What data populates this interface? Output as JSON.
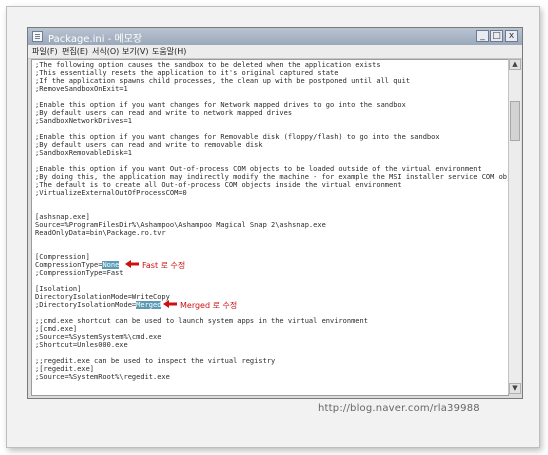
{
  "window": {
    "title": "Package.ini - 메모장",
    "controls": {
      "minimize": "_",
      "maximize": "□",
      "close": "x"
    }
  },
  "menu": [
    "파일(F)",
    "편집(E)",
    "서식(O)",
    "보기(V)",
    "도움말(H)"
  ],
  "lines": [
    ";The following option causes the sandbox to be deleted when the application exists",
    ";This essentially resets the application to it's original captured state",
    ";If the application spawns child processes, the clean up with be postponed until all quit",
    ";RemoveSandboxOnExit=1",
    "",
    ";Enable this option if you want changes for Network mapped drives to go into the sandbox",
    ";By default users can read and write to network mapped drives",
    ";SandboxNetworkDrives=1",
    "",
    ";Enable this option if you want changes for Removable disk (floppy/flash) to go into the sandbox",
    ";By default users can read and write to removable disk",
    ";SandboxRemovableDisk=1",
    "",
    ";Enable this option if you want Out-of-process COM objects to be loaded outside of the virtual environment",
    ";By doing this, the application may indirectly modify the machine - for example the MSI installer service COM object",
    ";The default is to create all Out-of-process COM objects inside the virtual environment",
    ";VirtualizeExternalOutOfProcessCOM=0",
    "",
    "",
    "[ashsnap.exe]",
    "Source=%ProgramFilesDir%\\Ashampoo\\Ashampoo Magical Snap 2\\ashsnap.exe",
    "ReadOnlyData=bin\\Package.ro.tvr",
    "",
    "",
    "[Compression]",
    "CompressionType=None",
    ";CompressionType=Fast",
    "",
    "[Isolation]",
    "DirectoryIsolationMode=WriteCopy",
    ";DirectoryIsolationMode=Merged",
    "",
    ";;cmd.exe shortcut can be used to launch system apps in the virtual environment",
    ";[cmd.exe]",
    ";Source=%SystemSystem%\\cmd.exe",
    ";Shortcut=Unles000.exe",
    "",
    ";;regedit.exe can be used to inspect the virtual registry",
    ";[regedit.exe]",
    ";Source=%SystemRoot%\\regedit.exe"
  ],
  "highlights": {
    "compression_prefix": "CompressionType=",
    "compression_value": "None",
    "isolation_prefix": ";DirectoryIsolationMode=",
    "isolation_value": "Merged"
  },
  "annotations": {
    "fast_note": "Fast 로 수정",
    "merged_note": "Merged 로 수정",
    "arrow_color": "#cc1111"
  },
  "scrollbar": {
    "up": "▲",
    "down": "▼"
  },
  "watermark": "http://blog.naver.com/rla39988"
}
